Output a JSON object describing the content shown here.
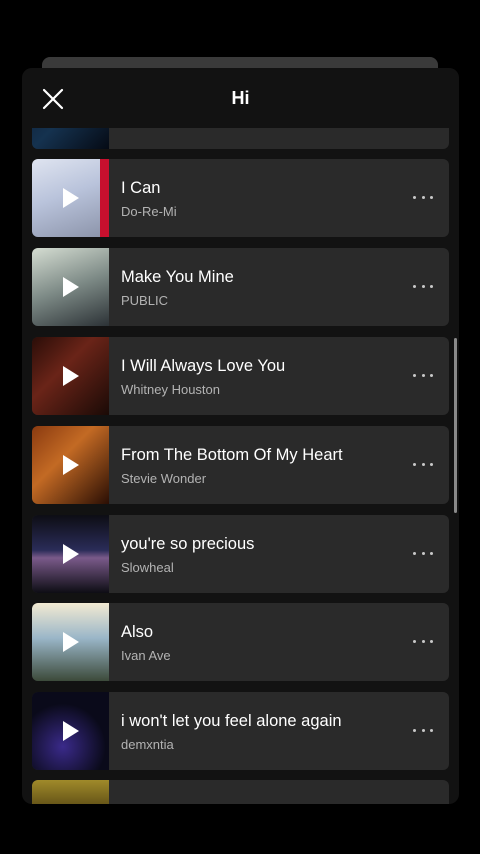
{
  "sheet": {
    "title": "Hi",
    "close_icon": "close-icon"
  },
  "tracks": [
    {
      "title": "I Can",
      "artist": "Do-Re-Mi"
    },
    {
      "title": "Make You Mine",
      "artist": "PUBLIC"
    },
    {
      "title": "I Will Always Love You",
      "artist": "Whitney Houston"
    },
    {
      "title": "From The Bottom Of My Heart",
      "artist": "Stevie Wonder"
    },
    {
      "title": "you're so precious",
      "artist": "Slowheal"
    },
    {
      "title": "Also",
      "artist": "Ivan Ave"
    },
    {
      "title": "i won't let you feel alone again",
      "artist": "demxntia"
    }
  ],
  "colors": {
    "background": "#000000",
    "sheet": "#121212",
    "card": "#2a2a2a",
    "secondary_text": "#b3b3b3"
  }
}
